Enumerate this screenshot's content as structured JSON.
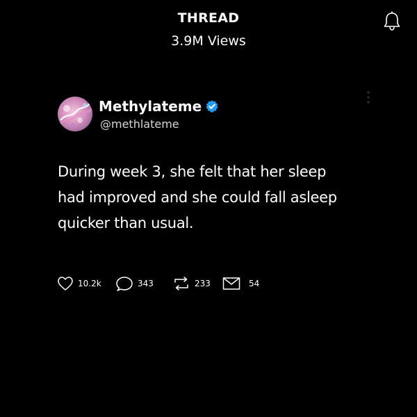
{
  "header": {
    "title": "THREAD",
    "views": "3.9M Views",
    "bell_icon": "bell-icon"
  },
  "post": {
    "author": {
      "display_name": "Methylateme",
      "handle": "@methlateme",
      "verified_color": "#1d9bf0"
    },
    "text": "During week 3, she felt that her sleep had improved and she could fall asleep quicker than usual.",
    "more_icon": "more-vertical-icon",
    "actions": {
      "likes": "10.2k",
      "replies": "343",
      "reposts": "233",
      "messages": "54"
    }
  },
  "colors": {
    "background": "#000000",
    "text": "#ffffff",
    "muted": "#d6d6d6",
    "dim_icon": "#2a2a2a"
  }
}
